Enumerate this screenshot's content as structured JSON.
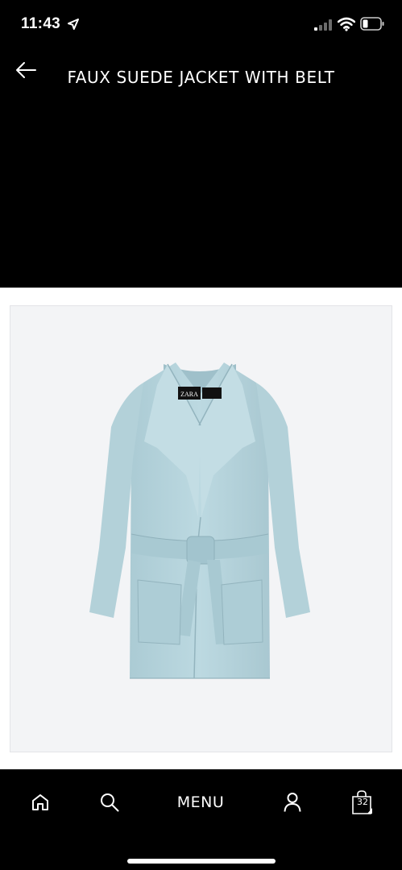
{
  "status_bar": {
    "time": "11:43",
    "icons": [
      "location-icon",
      "signal-icon",
      "wifi-icon",
      "battery-icon"
    ]
  },
  "header": {
    "back_icon": "arrow-left-icon",
    "title": "FAUX SUEDE JACKET WITH BELT"
  },
  "product": {
    "image": "light-blue-faux-suede-jacket-with-belt",
    "brand_label": "ZARA"
  },
  "bottom_nav": {
    "items": [
      {
        "icon": "home-icon"
      },
      {
        "icon": "search-icon"
      },
      {
        "label": "MENU"
      },
      {
        "icon": "user-icon"
      },
      {
        "icon": "shopping-bag-icon",
        "count": "32"
      }
    ]
  },
  "colors": {
    "background": "#000000",
    "product_background": "#f3f4f6",
    "jacket": "#bad7df"
  }
}
